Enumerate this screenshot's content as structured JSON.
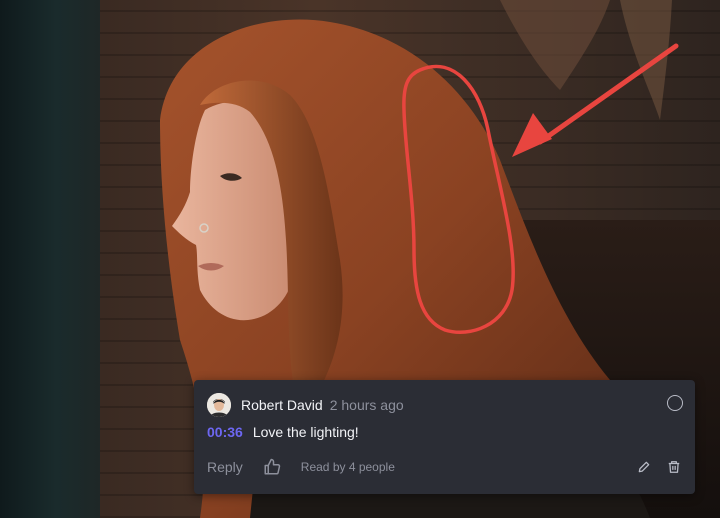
{
  "colors": {
    "card_bg": "#2b2d35",
    "timestamp_accent": "#6d67f2",
    "annotation_red": "#e8453f"
  },
  "comment": {
    "author": "Robert David",
    "time": "2 hours ago",
    "timestamp": "00:36",
    "text": "Love the lighting!",
    "reply_label": "Reply",
    "read_by": "Read by 4 people"
  },
  "icons": {
    "avatar": "user-avatar",
    "resolve": "circle-icon",
    "like": "thumbs-up-icon",
    "edit": "pencil-icon",
    "delete": "trash-icon"
  }
}
